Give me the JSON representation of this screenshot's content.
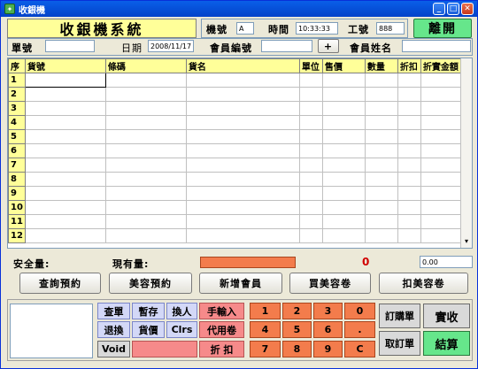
{
  "window": {
    "title": "收銀機"
  },
  "header": {
    "app_title": "收銀機系統",
    "machine_label": "機號",
    "machine_value": "A",
    "time_label": "時間",
    "time_value": "10:33:33",
    "staff_label": "工號",
    "staff_value": "888",
    "exit_label": "離開"
  },
  "info": {
    "order_label": "單號",
    "order_value": "",
    "date_label": "日期",
    "date_value": "2008/11/17",
    "member_no_label": "會員編號",
    "member_no_value": "",
    "plus_label": "+",
    "member_name_label": "會員姓名",
    "member_name_value": ""
  },
  "table": {
    "columns": [
      "序",
      "貨號",
      "條碼",
      "貨名",
      "單位",
      "售價",
      "數量",
      "折扣",
      "折實金額"
    ],
    "rows": [
      "1",
      "2",
      "3",
      "4",
      "5",
      "6",
      "7",
      "8",
      "9",
      "10",
      "11",
      "12"
    ]
  },
  "status": {
    "safety_label": "安全量:",
    "stock_label": "現有量:",
    "total_value": "0",
    "amount_value": "0.00"
  },
  "actions": [
    "查詢預約",
    "美容預約",
    "新增會員",
    "買美容卷",
    "扣美容卷"
  ],
  "keypad": {
    "func": [
      "查單",
      "暫存",
      "換人",
      "手輸入",
      "退換",
      "貨價",
      "Clrs",
      "代用卷",
      "Void",
      "",
      "折 扣"
    ],
    "digits": [
      "1",
      "2",
      "3",
      "0",
      "4",
      "5",
      "6",
      ".",
      "7",
      "8",
      "9",
      "C"
    ],
    "side": [
      "訂購單",
      "取訂單"
    ],
    "pay": [
      "實收",
      "結算"
    ]
  },
  "colors": {
    "title_bg": "#ffff99",
    "exit_bg": "#66e68b",
    "orange": "#f37c4c",
    "pink": "#f68a8a",
    "blue": "#d3d8f7"
  }
}
